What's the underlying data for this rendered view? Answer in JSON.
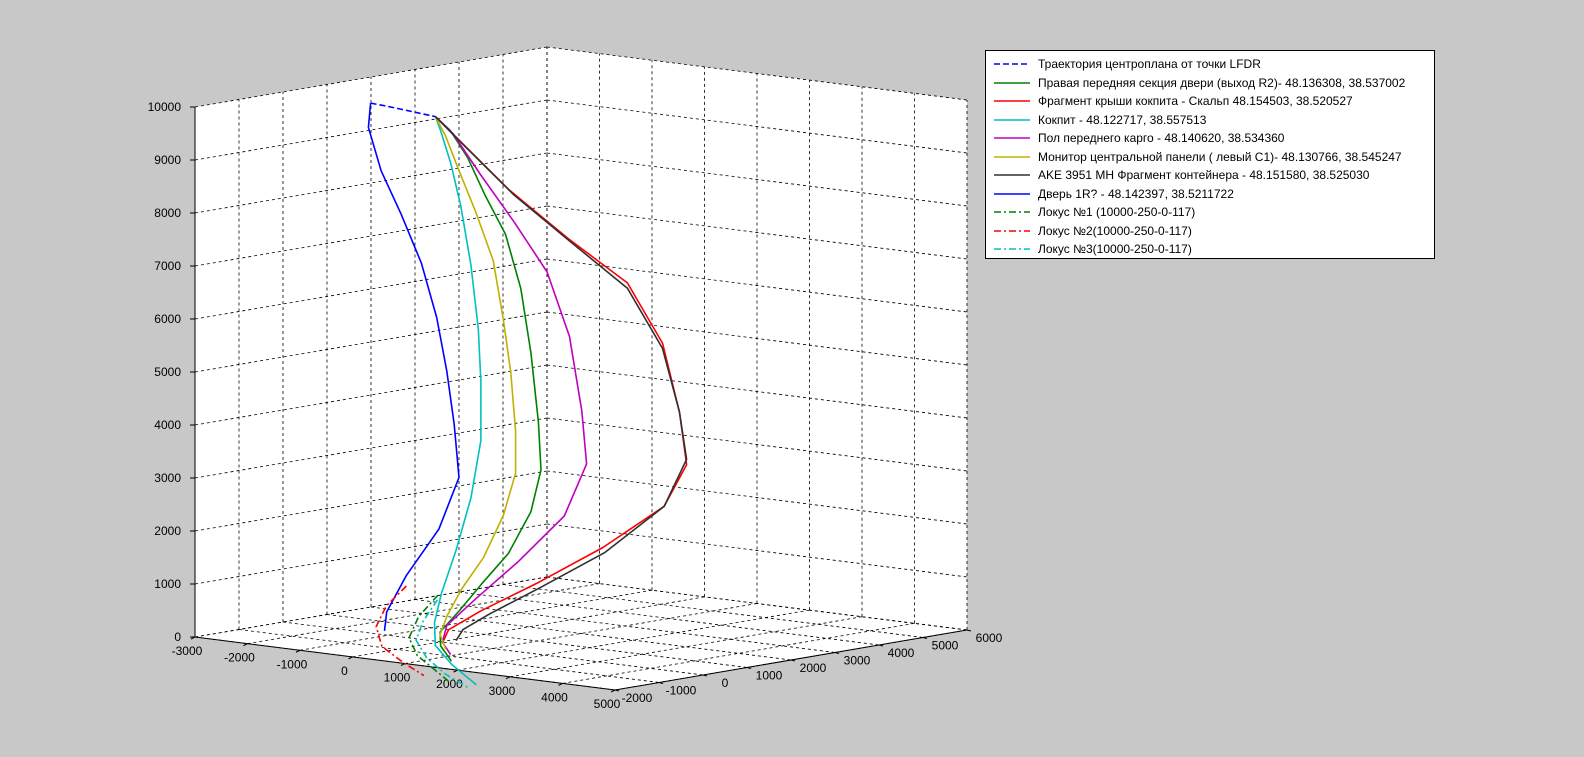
{
  "chart_data": {
    "type": "line",
    "title": "",
    "xlabel": "",
    "ylabel": "",
    "zlabel": "",
    "grid": true,
    "legend_position": "top-right",
    "axes": {
      "x": {
        "range": [
          -3000,
          5000
        ],
        "ticks": [
          -3000,
          -2000,
          -1000,
          0,
          1000,
          2000,
          3000,
          4000,
          5000
        ]
      },
      "y": {
        "range": [
          -2000,
          6000
        ],
        "ticks": [
          -2000,
          -1000,
          0,
          1000,
          2000,
          3000,
          4000,
          5000,
          6000
        ]
      },
      "z": {
        "range": [
          0,
          10000
        ],
        "ticks": [
          0,
          1000,
          2000,
          3000,
          4000,
          5000,
          6000,
          7000,
          8000,
          9000,
          10000
        ]
      }
    },
    "series": [
      {
        "name": "Траектория центроплана от точки LFDR",
        "color": "#0000ff",
        "style": "dashed",
        "points": [
          [
            -1500,
            200,
            9950
          ],
          [
            -1200,
            300,
            9900
          ],
          [
            -600,
            600,
            9750
          ]
        ]
      },
      {
        "name": "Правая передняя секция двери (выход R2)- 48.136308, 38.537002",
        "color": "#008000",
        "style": "solid",
        "points": [
          [
            -600,
            600,
            9750
          ],
          [
            -400,
            700,
            9500
          ],
          [
            -150,
            800,
            9000
          ],
          [
            100,
            900,
            8300
          ],
          [
            400,
            1000,
            7600
          ],
          [
            650,
            1050,
            6600
          ],
          [
            800,
            1100,
            5400
          ],
          [
            900,
            1150,
            4100
          ],
          [
            950,
            1150,
            3200
          ],
          [
            800,
            1100,
            2400
          ],
          [
            500,
            950,
            1600
          ],
          [
            150,
            750,
            1000
          ],
          [
            -100,
            550,
            500
          ],
          [
            -300,
            350,
            100
          ],
          [
            -250,
            300,
            -150
          ],
          [
            0,
            250,
            -400
          ]
        ]
      },
      {
        "name": "Фрагмент крыши кокпита - Скальп 48.154503, 38.520527",
        "color": "#ff0000",
        "style": "solid",
        "points": [
          [
            -600,
            600,
            9750
          ],
          [
            -300,
            800,
            9300
          ],
          [
            300,
            1200,
            8400
          ],
          [
            1000,
            1700,
            7500
          ],
          [
            1800,
            2100,
            6700
          ],
          [
            2300,
            2300,
            5600
          ],
          [
            2500,
            2450,
            4300
          ],
          [
            2550,
            2550,
            3300
          ],
          [
            2250,
            2400,
            2500
          ],
          [
            1500,
            1900,
            1700
          ],
          [
            700,
            1350,
            1000
          ],
          [
            0,
            900,
            450
          ],
          [
            -350,
            600,
            100
          ],
          [
            -400,
            550,
            -100
          ]
        ]
      },
      {
        "name": "Кокпит - 48.122717, 38.557513",
        "color": "#00c0c0",
        "style": "solid",
        "points": [
          [
            -600,
            600,
            9750
          ],
          [
            -500,
            600,
            9500
          ],
          [
            -350,
            650,
            8900
          ],
          [
            -200,
            700,
            8100
          ],
          [
            -50,
            750,
            7000
          ],
          [
            50,
            800,
            5800
          ],
          [
            100,
            800,
            4800
          ],
          [
            100,
            800,
            3700
          ],
          [
            -50,
            750,
            2600
          ],
          [
            -250,
            650,
            1600
          ],
          [
            -400,
            500,
            800
          ],
          [
            -450,
            400,
            250
          ],
          [
            -350,
            300,
            -150
          ],
          [
            50,
            200,
            -450
          ],
          [
            600,
            100,
            -750
          ]
        ]
      },
      {
        "name": "Пол переднего карго - 48.140620, 38.534360",
        "color": "#c000c0",
        "style": "solid",
        "points": [
          [
            -600,
            600,
            9750
          ],
          [
            -350,
            700,
            9450
          ],
          [
            0,
            900,
            8700
          ],
          [
            450,
            1150,
            7800
          ],
          [
            900,
            1350,
            6900
          ],
          [
            1200,
            1500,
            5700
          ],
          [
            1350,
            1600,
            4300
          ],
          [
            1400,
            1650,
            3300
          ],
          [
            1100,
            1500,
            2300
          ],
          [
            500,
            1150,
            1400
          ],
          [
            0,
            800,
            700
          ],
          [
            -300,
            500,
            200
          ],
          [
            -300,
            400,
            -100
          ],
          [
            -100,
            350,
            -300
          ]
        ]
      },
      {
        "name": "Монитор центральной панели ( левый С1)- 48.130766, 38.545247",
        "color": "#c0b000",
        "style": "solid",
        "points": [
          [
            -600,
            600,
            9750
          ],
          [
            -450,
            650,
            9400
          ],
          [
            -250,
            700,
            8800
          ],
          [
            0,
            800,
            8000
          ],
          [
            250,
            900,
            7100
          ],
          [
            400,
            950,
            6000
          ],
          [
            500,
            1000,
            5000
          ],
          [
            550,
            1050,
            3900
          ],
          [
            550,
            1050,
            3100
          ],
          [
            400,
            950,
            2300
          ],
          [
            150,
            800,
            1500
          ],
          [
            -100,
            600,
            900
          ],
          [
            -250,
            450,
            400
          ],
          [
            -300,
            350,
            50
          ],
          [
            -150,
            300,
            -200
          ]
        ]
      },
      {
        "name": "AKE 3951 MH Фрагмент контейнера - 48.151580, 38.525030",
        "color": "#303030",
        "style": "solid",
        "points": [
          [
            -600,
            600,
            9750
          ],
          [
            -250,
            850,
            9200
          ],
          [
            350,
            1250,
            8300
          ],
          [
            1050,
            1750,
            7400
          ],
          [
            1800,
            2100,
            6600
          ],
          [
            2300,
            2300,
            5500
          ],
          [
            2500,
            2450,
            4300
          ],
          [
            2550,
            2550,
            3400
          ],
          [
            2250,
            2400,
            2500
          ],
          [
            1500,
            1950,
            1600
          ],
          [
            700,
            1400,
            900
          ],
          [
            100,
            1000,
            400
          ],
          [
            -200,
            750,
            100
          ],
          [
            -250,
            650,
            -100
          ]
        ]
      },
      {
        "name": "Дверь 1R? - 48.142397, 38.5211722",
        "color": "#0000ff",
        "style": "solid",
        "points": [
          [
            -1500,
            200,
            9950
          ],
          [
            -1500,
            150,
            9500
          ],
          [
            -1300,
            200,
            8700
          ],
          [
            -1000,
            300,
            7900
          ],
          [
            -700,
            400,
            7000
          ],
          [
            -450,
            450,
            6000
          ],
          [
            -300,
            500,
            5000
          ],
          [
            -200,
            550,
            4000
          ],
          [
            -150,
            600,
            3000
          ],
          [
            -450,
            500,
            2000
          ],
          [
            -900,
            300,
            1100
          ],
          [
            -1150,
            150,
            400
          ],
          [
            -1150,
            100,
            50
          ]
        ]
      },
      {
        "name": "Локус №1 (10000-250-0-117)",
        "color": "#008000",
        "style": "dashdot",
        "points": [
          [
            -300,
            300,
            800
          ],
          [
            -500,
            100,
            400
          ],
          [
            -600,
            0,
            0
          ],
          [
            -400,
            -50,
            -300
          ],
          [
            -50,
            -100,
            -500
          ],
          [
            300,
            -150,
            -700
          ]
        ]
      },
      {
        "name": "Локус №2(10000-250-0-117)",
        "color": "#ff0000",
        "style": "dashdot",
        "points": [
          [
            -900,
            300,
            900
          ],
          [
            -1200,
            200,
            500
          ],
          [
            -1350,
            150,
            100
          ],
          [
            -1200,
            100,
            -250
          ],
          [
            -800,
            100,
            -500
          ],
          [
            -400,
            100,
            -700
          ]
        ]
      },
      {
        "name": "Локус №3(10000-250-0-117)",
        "color": "#00c0c0",
        "style": "dashdot",
        "points": [
          [
            -350,
            350,
            700
          ],
          [
            -500,
            200,
            300
          ],
          [
            -550,
            100,
            -50
          ],
          [
            -300,
            50,
            -350
          ],
          [
            100,
            0,
            -600
          ],
          [
            600,
            -50,
            -800
          ]
        ]
      }
    ]
  }
}
